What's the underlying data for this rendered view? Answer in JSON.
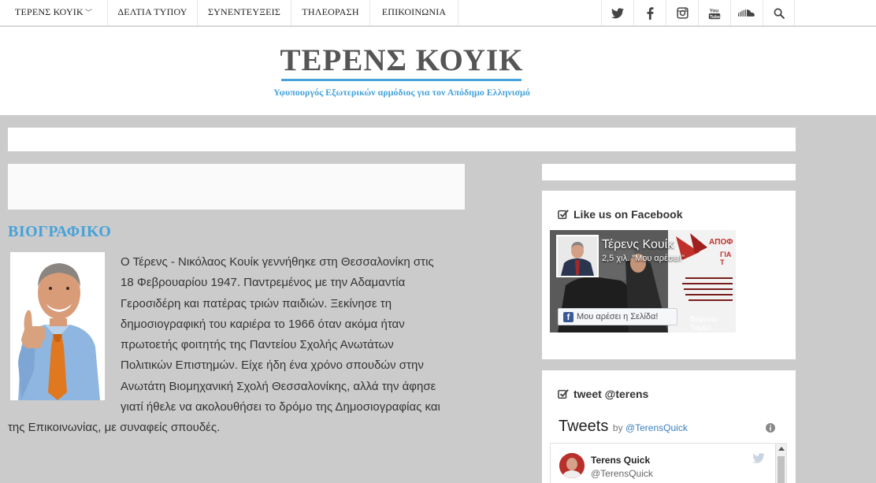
{
  "nav": {
    "items": [
      "ΤΕΡΕΝΣ ΚΟΥΙΚ",
      "ΔΕΛΤΙΑ ΤΥΠΟΥ",
      "ΣΥΝΕΝΤΕΥΞΕΙΣ",
      "ΤΗΛΕΟΡΑΣΗ",
      "ΕΠΙΚΟΙΝΩΝΙΑ"
    ],
    "social_icons": [
      "twitter-icon",
      "facebook-icon",
      "instagram-icon",
      "youtube-icon",
      "soundcloud-icon",
      "search-icon"
    ]
  },
  "header": {
    "title": "ΤΕΡΕΝΣ ΚΟΥΙΚ",
    "subtitle": "Υφυπουργός Εξωτερικών αρμόδιος για τον Απόδημο Ελληνισμό"
  },
  "bio": {
    "heading": "ΒΙΟΓΡΑΦΙΚΟ",
    "lines": [
      "Ο Τέρενς - Νικόλαος Κουίκ γεννήθηκε στη Θεσσαλονίκη στις",
      "18 Φεβρουαρίου 1947. Παντρεμένος με την Αδαμαντία",
      "Γεροσιδέρη και πατέρας τριών παιδιών. Ξεκίνησε τη",
      "δημοσιογραφική του καριέρα το 1966 όταν ακόμα ήταν",
      "πρωτοετής φοιτητής της Παντείου Σχολής Ανωτάτων",
      "Πολιτικών Επιστημών. Είχε ήδη ένα χρόνο σπουδών στην",
      "Ανωτάτη Βιομηχανική Σχολή Θεσσαλονίκης, αλλά την άφησε",
      "γιατί ήθελε να ακολουθήσει το δρόμο της Δημοσιογραφίας και",
      "της  Επικοινωνίας, με συναφείς σπουδές."
    ]
  },
  "facebook": {
    "title": "Like us on Facebook",
    "page_name": "Τέρενς Κουίκ",
    "likes": "2,5 χιλ. \"Μου αρέσει!\"",
    "like_button": "Μου αρέσει η Σελίδα!",
    "cover_text_1": "ΑΠΟΦ",
    "cover_text_2": "ΓΙΑ Τ",
    "cover_region": "Βόρειου Τομέα"
  },
  "twitter": {
    "title": "tweet @terens",
    "tweets_label": "Tweets",
    "by_label": "by",
    "by_handle": "@TerensQuick",
    "user_name": "Terens Quick",
    "user_handle": "@TerensQuick"
  },
  "colors": {
    "accent": "#45a2db",
    "background": "#cccbcb",
    "facebook_blue": "#3b5998"
  }
}
